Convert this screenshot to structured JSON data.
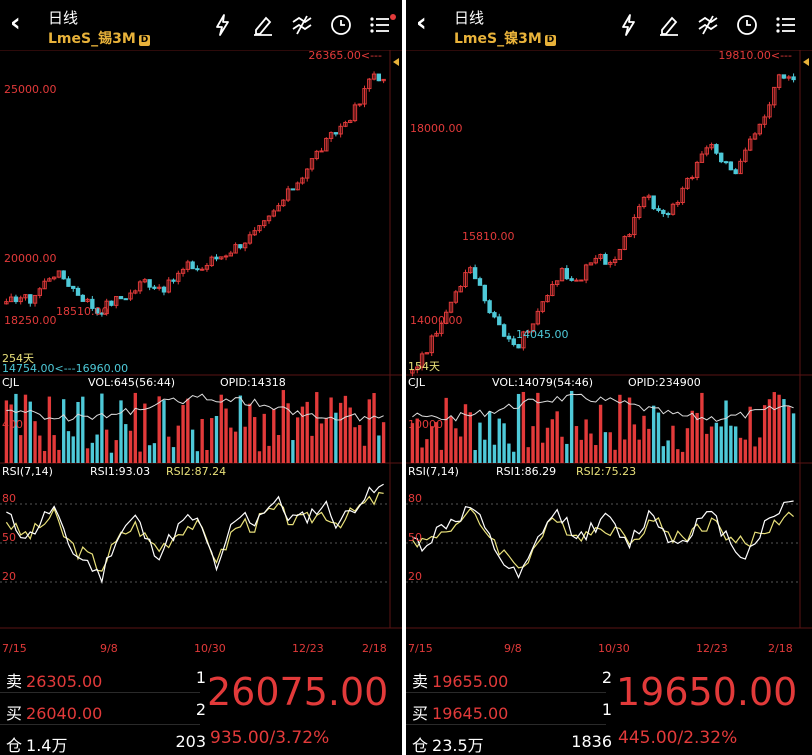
{
  "panels": [
    {
      "id": "tin",
      "period": "日线",
      "symbol": "LmeS_锡3M",
      "badge": "D",
      "colors": {
        "up": "#e23a3a",
        "down": "#4ec9d8",
        "rsi1": "#ffffff",
        "rsi2": "#e8e07a"
      },
      "price_labels": {
        "max_marker": "26365.00<---",
        "upper": "25000.00",
        "mid": "20000.00",
        "lower": "18250.00",
        "peak_local": "18510.00",
        "min_marker": "14754.00<---16960.00",
        "days": "254天"
      },
      "vol_header": {
        "label": "CJL",
        "vol": "VOL:645(56:44)",
        "opi": "OPID:14318",
        "axis": "400"
      },
      "rsi_header": {
        "label": "RSI(7,14)",
        "rsi1": "RSI1:93.03",
        "rsi2": "RSI2:87.24"
      },
      "rsi_axis": [
        "80",
        "50",
        "20"
      ],
      "dates": [
        "7/15",
        "9/8",
        "10/30",
        "12/23",
        "2/18"
      ],
      "quote": {
        "sell_label": "卖",
        "sell_price": "26305.00",
        "sell_qty": "1",
        "buy_label": "买",
        "buy_price": "26040.00",
        "buy_qty": "2",
        "oi_label": "仓",
        "oi_value": "1.4万",
        "oi_num": "203",
        "last": "26075.00",
        "change": "935.00/3.72%"
      },
      "chart_data": {
        "type": "line",
        "title": "LmeS_锡3M",
        "x": [
          "7/15",
          "9/8",
          "10/30",
          "12/23",
          "2/18"
        ],
        "y_axis_ticks": [
          18250,
          20000,
          25000
        ],
        "series": [
          {
            "name": "close",
            "values": [
              17200,
              17600,
              17400,
              17900,
              18510,
              18300,
              17800,
              17400,
              16960,
              17300,
              17500,
              17700,
              18200,
              18000,
              17900,
              18400,
              18800,
              18600,
              19000,
              19200,
              19500,
              19800,
              20100,
              20600,
              21200,
              21800,
              22400,
              23100,
              23600,
              24100,
              24600,
              25200,
              26365,
              26075
            ]
          },
          {
            "name": "RSI1",
            "values": [
              72,
              60,
              55,
              68,
              78,
              52,
              40,
              35,
              22,
              48,
              62,
              70,
              50,
              42,
              55,
              66,
              70,
              50,
              28,
              60,
              72,
              66,
              78,
              82,
              70,
              68,
              74,
              80,
              66,
              72,
              84,
              88,
              93
            ]
          },
          {
            "name": "RSI2",
            "values": [
              68,
              58,
              56,
              64,
              72,
              54,
              44,
              40,
              30,
              46,
              58,
              64,
              52,
              46,
              54,
              62,
              65,
              52,
              36,
              56,
              66,
              63,
              72,
              76,
              68,
              66,
              70,
              74,
              66,
              70,
              78,
              82,
              87
            ]
          }
        ],
        "ylim": [
          14754,
          26365
        ]
      }
    },
    {
      "id": "nickel",
      "period": "日线",
      "symbol": "LmeS_镍3M",
      "badge": "D",
      "colors": {
        "up": "#e23a3a",
        "down": "#4ec9d8",
        "rsi1": "#ffffff",
        "rsi2": "#e8e07a"
      },
      "price_labels": {
        "max_marker": "19810.00<---",
        "upper": "18000.00",
        "mid": "15810.00",
        "lower": "14000.00",
        "peak_local": "14045.00",
        "min_marker": "",
        "days": "154天"
      },
      "vol_header": {
        "label": "CJL",
        "vol": "VOL:14079(54:46)",
        "opi": "OPID:234900",
        "axis": "10000"
      },
      "rsi_header": {
        "label": "RSI(7,14)",
        "rsi1": "RSI1:86.29",
        "rsi2": "RSI2:75.23"
      },
      "rsi_axis": [
        "80",
        "50",
        "20"
      ],
      "dates": [
        "7/15",
        "9/8",
        "10/30",
        "12/23",
        "2/18"
      ],
      "quote": {
        "sell_label": "卖",
        "sell_price": "19655.00",
        "sell_qty": "2",
        "buy_label": "买",
        "buy_price": "19645.00",
        "buy_qty": "1",
        "oi_label": "仓",
        "oi_value": "23.5万",
        "oi_num": "1836",
        "last": "19650.00",
        "change": "445.00/2.32%"
      },
      "chart_data": {
        "type": "line",
        "title": "LmeS_镍3M",
        "x": [
          "7/15",
          "9/8",
          "10/30",
          "12/23",
          "2/18"
        ],
        "y_axis_ticks": [
          14000,
          18000
        ],
        "series": [
          {
            "name": "close",
            "values": [
              13600,
              13900,
              14300,
              14800,
              15300,
              15810,
              15200,
              14700,
              14300,
              14045,
              14400,
              14900,
              15200,
              15600,
              15300,
              15700,
              16000,
              15800,
              16100,
              16500,
              17300,
              17000,
              16800,
              17100,
              17600,
              18000,
              18300,
              17900,
              17700,
              18200,
              18600,
              19200,
              19810,
              19650
            ]
          },
          {
            "name": "RSI1",
            "values": [
              52,
              48,
              58,
              66,
              70,
              78,
              60,
              44,
              30,
              22,
              40,
              62,
              72,
              66,
              54,
              60,
              70,
              62,
              48,
              60,
              74,
              62,
              48,
              56,
              66,
              72,
              60,
              48,
              40,
              56,
              68,
              78,
              86
            ]
          },
          {
            "name": "RSI2",
            "values": [
              54,
              50,
              56,
              62,
              66,
              72,
              62,
              50,
              38,
              32,
              42,
              58,
              66,
              62,
              56,
              58,
              64,
              60,
              52,
              58,
              68,
              62,
              54,
              56,
              62,
              66,
              60,
              52,
              48,
              56,
              62,
              70,
              75
            ]
          }
        ],
        "ylim": [
          13600,
          19810
        ]
      }
    }
  ]
}
